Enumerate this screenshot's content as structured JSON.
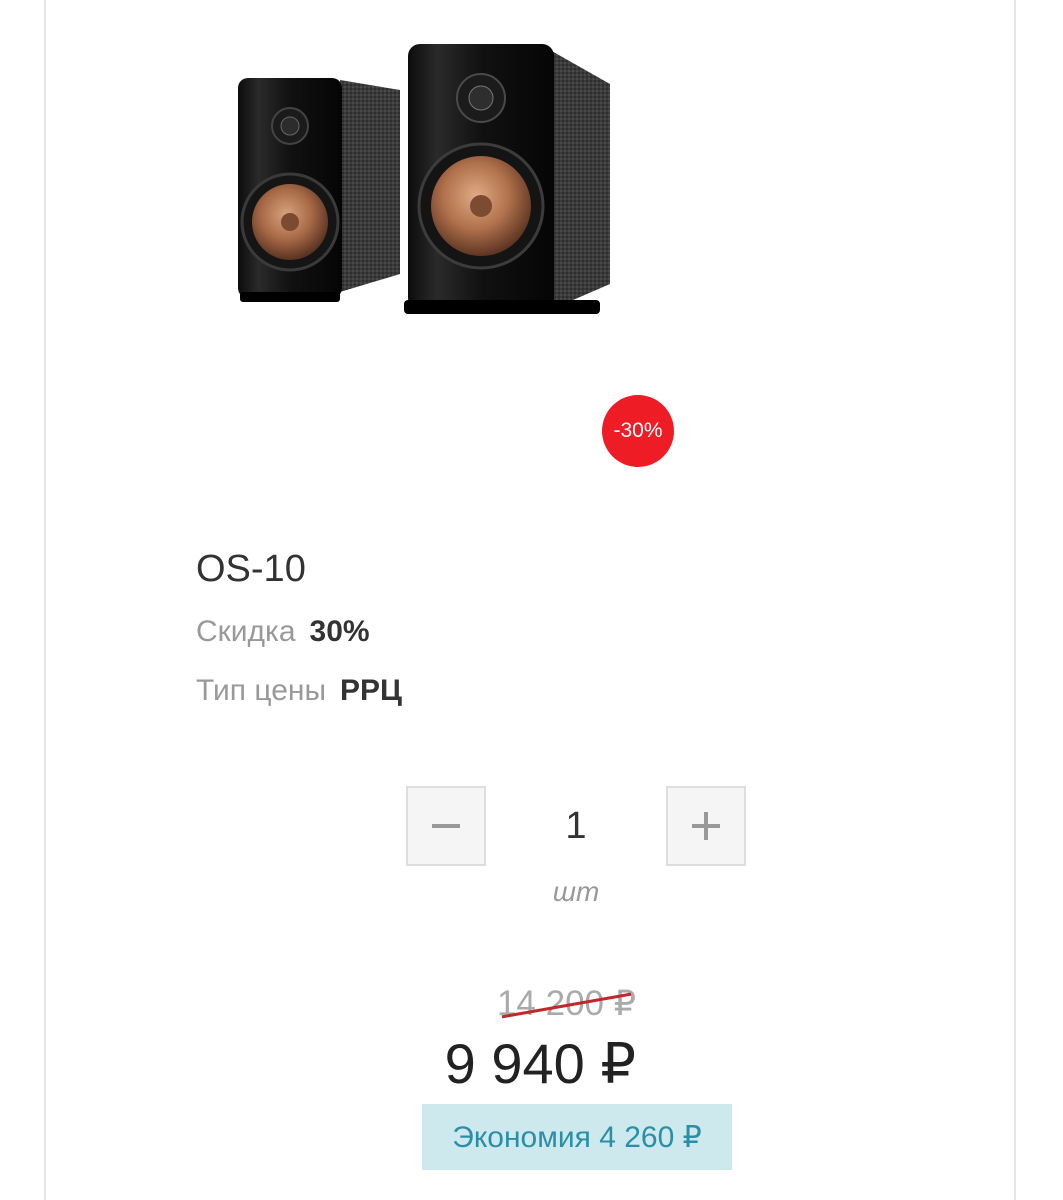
{
  "product": {
    "name": "OS-10",
    "badge": "-30%",
    "image_alt": "speakers"
  },
  "params": {
    "discount_label": "Скидка",
    "discount_value": "30%",
    "price_type_label": "Тип цены",
    "price_type_value": "РРЦ"
  },
  "quantity": {
    "value": "1",
    "unit": "шт",
    "minus_icon": "minus-icon",
    "plus_icon": "plus-icon"
  },
  "price": {
    "old": "14 200 ₽",
    "new": "9 940 ₽",
    "savings": "Экономия 4 260 ₽"
  },
  "colors": {
    "badge": "#ee1c25",
    "strike": "#c0282d",
    "savings_bg": "#cde9ee",
    "savings_text": "#2a8fa6"
  }
}
